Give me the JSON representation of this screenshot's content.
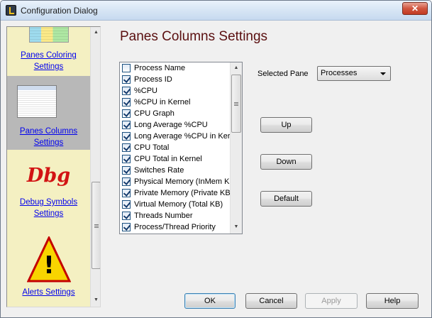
{
  "window": {
    "title": "Configuration Dialog"
  },
  "titlebar": {
    "close_glyph": "✕"
  },
  "nav": {
    "items": [
      {
        "label": "Panes Coloring Settings",
        "line1": "Panes Coloring",
        "line2": "Settings",
        "selected": false
      },
      {
        "label": "Panes Columns Settings",
        "line1": "Panes Columns",
        "line2": "Settings",
        "selected": true
      },
      {
        "label": "Debug Symbols Settings",
        "line1": "Debug Symbols",
        "line2": "Settings",
        "selected": false
      },
      {
        "label": "Alerts Settings",
        "line1": "Alerts Settings",
        "line2": "",
        "selected": false
      }
    ],
    "dbg_text": "Dbg",
    "warning_glyph": "!",
    "scroll_up_glyph": "▲",
    "scroll_down_glyph": "▼"
  },
  "heading": "Panes Columns Settings",
  "columns": [
    {
      "label": "Process Name",
      "checked": false
    },
    {
      "label": "Process ID",
      "checked": true
    },
    {
      "label": "%CPU",
      "checked": true
    },
    {
      "label": "%CPU in Kernel",
      "checked": true
    },
    {
      "label": "CPU Graph",
      "checked": true
    },
    {
      "label": "Long Average %CPU",
      "checked": true
    },
    {
      "label": "Long Average %CPU in Kernel",
      "checked": true
    },
    {
      "label": "CPU Total",
      "checked": true
    },
    {
      "label": "CPU Total in Kernel",
      "checked": true
    },
    {
      "label": "Switches Rate",
      "checked": true
    },
    {
      "label": "Physical Memory (InMem KB)",
      "checked": true
    },
    {
      "label": "Private Memory (Private KB)",
      "checked": true
    },
    {
      "label": "Virtual Memory (Total KB)",
      "checked": true
    },
    {
      "label": "Threads Number",
      "checked": true
    },
    {
      "label": "Process/Thread Priority",
      "checked": true
    }
  ],
  "selected_pane": {
    "label": "Selected Pane",
    "value": "Processes"
  },
  "buttons": {
    "up": "Up",
    "down": "Down",
    "default": "Default",
    "ok": "OK",
    "cancel": "Cancel",
    "apply": "Apply",
    "help": "Help"
  }
}
